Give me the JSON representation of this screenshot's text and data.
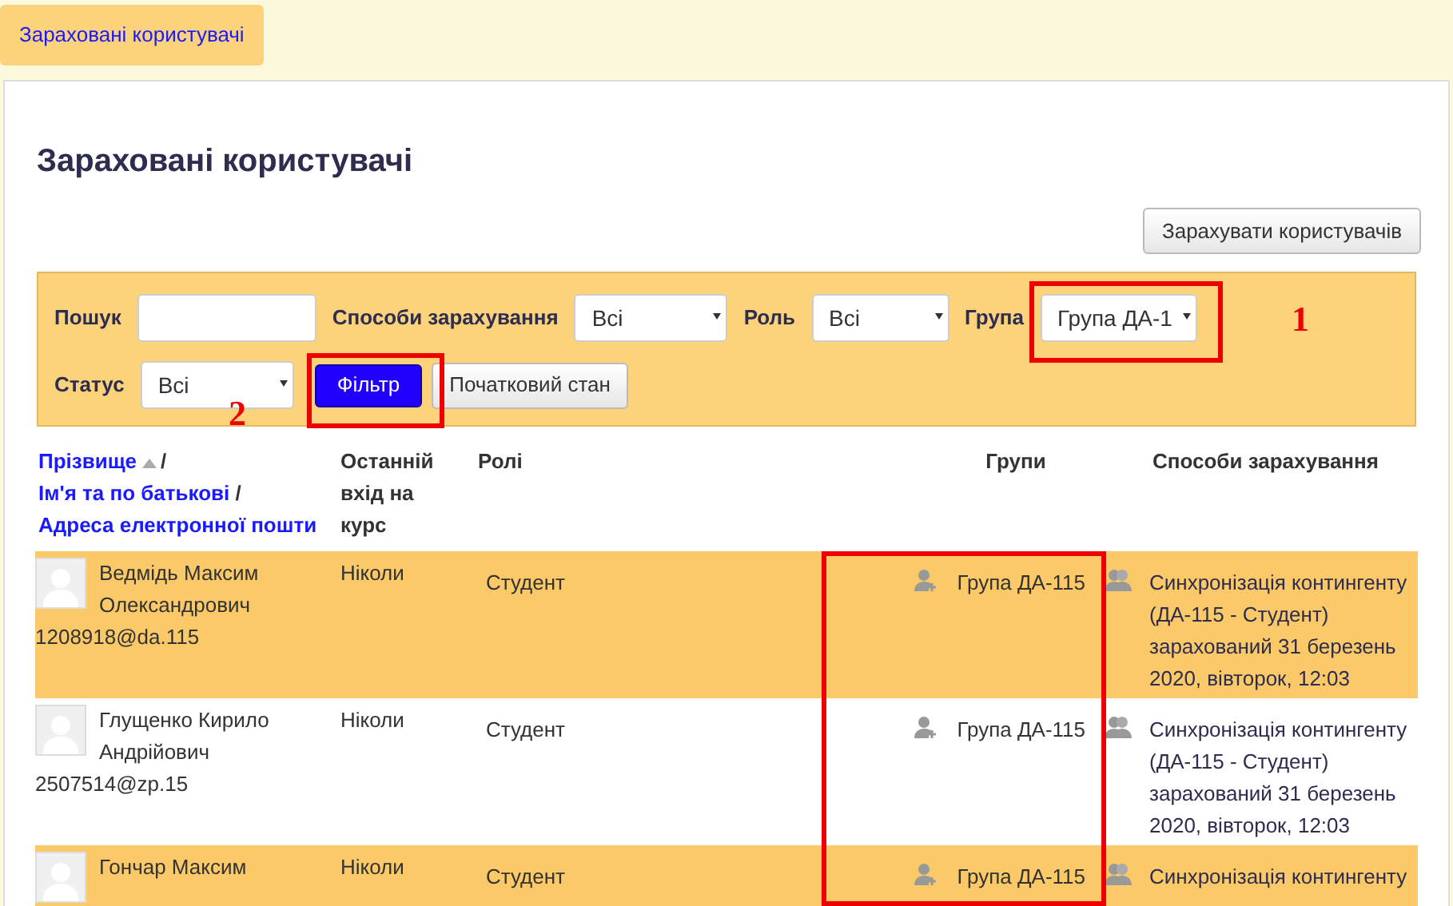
{
  "tab": {
    "label": "Зараховані користувачі",
    "selected": true
  },
  "heading": "Зараховані користувачі",
  "enrol_button": "Зарахувати користувачів",
  "filters": [
    {
      "kind": "text",
      "label": "Пошук"
    },
    {
      "kind": "select",
      "label": "Способи зарахування",
      "value": "Всі"
    },
    {
      "kind": "select",
      "label": "Роль",
      "value": "Всі"
    },
    {
      "kind": "select",
      "label": "Група",
      "value": "Група ДА-1"
    },
    {
      "kind": "select",
      "label": "Статус",
      "value": "Всі"
    }
  ],
  "filter_button": "Фільтр",
  "reset_button": "Початковий стан",
  "columns": {
    "name": [
      "Прізвище",
      "Ім'я та по батькові",
      "Адреса електронної пошти"
    ],
    "separator": "/",
    "last_access": "Останній вхід на курс",
    "roles": "Ролі",
    "groups": "Групи",
    "enrolment": "Способи зарахування"
  },
  "rows": [
    {
      "name": "Ведмідь Максим Олександрович",
      "email": "1208918@da.115",
      "last_access": "Ніколи",
      "role": "Студент",
      "group": "Група ДА-115",
      "enrolment": "Синхронізація контингенту (ДА-115 - Студент) зарахований 31 березень 2020, вівторок, 12:03"
    },
    {
      "name": "Глущенко Кирило Андрійович",
      "email": "2507514@zp.15",
      "last_access": "Ніколи",
      "role": "Студент",
      "group": "Група ДА-115",
      "enrolment": "Синхронізація контингенту (ДА-115 - Студент) зарахований 31 березень 2020, вівторок, 12:03"
    },
    {
      "name": "Гончар Максим",
      "last_access": "Ніколи",
      "role": "Студент",
      "group": "Група ДА-115",
      "enrolment": "Синхронізація контингенту"
    }
  ],
  "annotations": [
    "1",
    "2"
  ]
}
